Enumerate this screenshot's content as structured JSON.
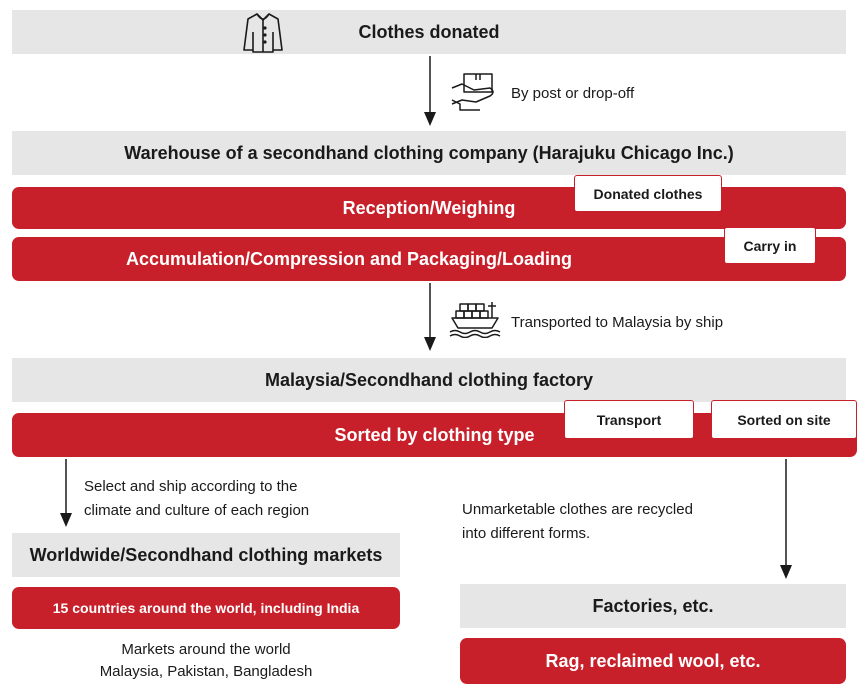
{
  "steps": {
    "donated": "Clothes donated",
    "warehouse": "Warehouse of a secondhand clothing company (Harajuku Chicago Inc.)",
    "reception": "Reception/Weighing",
    "accumulation": "Accumulation/Compression and Packaging/Loading",
    "malaysia_factory": "Malaysia/Secondhand clothing factory",
    "sorted": "Sorted by clothing type",
    "worldwide": "Worldwide/Secondhand clothing markets",
    "countries": "15 countries around the world, including India",
    "factories": "Factories, etc.",
    "rag": "Rag, reclaimed wool, etc."
  },
  "tags": {
    "donated_clothes": "Donated clothes",
    "carry_in": "Carry in",
    "transport": "Transport",
    "sorted_on_site": "Sorted on site"
  },
  "notes": {
    "post": "By post or drop-off",
    "ship": "Transported to Malaysia by ship",
    "select_line1": "Select and ship according to the",
    "select_line2": "climate and culture of each region",
    "recycle_line1": "Unmarketable clothes are recycled",
    "recycle_line2": "into different forms.",
    "markets_line1": "Markets around the world",
    "markets_line2": "Malaysia, Pakistan, Bangladesh"
  },
  "icons": {
    "shirt": "shirt-icon",
    "parcel": "parcel-hand-icon",
    "ship": "cargo-ship-icon"
  },
  "colors": {
    "accent_red": "#c8202a",
    "band_grey": "#e6e6e6"
  }
}
